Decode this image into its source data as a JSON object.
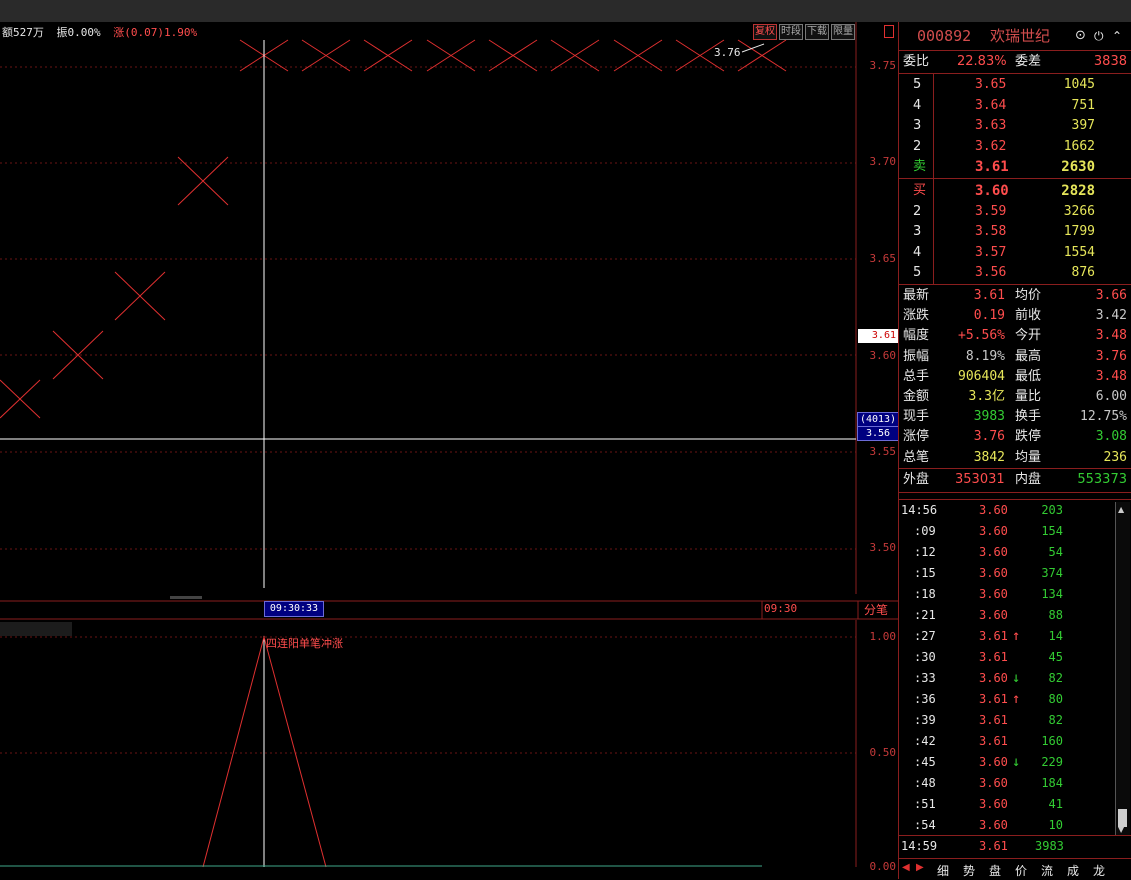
{
  "info": {
    "amount": "额527万",
    "amplitude": "振0.00%",
    "change": "涨(0.07)1.90%"
  },
  "toolbar": {
    "fuquan": "复权",
    "shiduan": "时段",
    "xiazai": "下载",
    "xianliang": "限量"
  },
  "chart": {
    "y_labels": [
      "3.75",
      "3.70",
      "3.65",
      "3.60",
      "3.55",
      "3.50"
    ],
    "annotation": "3.76",
    "current_price_marker": "3.61",
    "crosshair_volume": "(4013)",
    "crosshair_price": "3.56",
    "crosshair_time": "09:30:33",
    "axis_time_right": "09:30",
    "fenbi": "分笔",
    "lower_labels": [
      "1.00",
      "0.50",
      "0.00"
    ],
    "signal_label": "四连阳单笔冲涨"
  },
  "stock": {
    "code": "000892",
    "name": "欢瑞世纪"
  },
  "orderbook": {
    "weibi_label": "委比",
    "weibi": "22.83%",
    "weicha_label": "委差",
    "weicha": "3838",
    "sell": [
      {
        "level": "5",
        "price": "3.65",
        "vol": "1045"
      },
      {
        "level": "4",
        "price": "3.64",
        "vol": "751"
      },
      {
        "level": "3",
        "price": "3.63",
        "vol": "397"
      },
      {
        "level": "2",
        "price": "3.62",
        "vol": "1662"
      },
      {
        "level": "卖",
        "price": "3.61",
        "vol": "2630"
      }
    ],
    "buy": [
      {
        "level": "买",
        "price": "3.60",
        "vol": "2828"
      },
      {
        "level": "2",
        "price": "3.59",
        "vol": "3266"
      },
      {
        "level": "3",
        "price": "3.58",
        "vol": "1799"
      },
      {
        "level": "4",
        "price": "3.57",
        "vol": "1554"
      },
      {
        "level": "5",
        "price": "3.56",
        "vol": "876"
      }
    ]
  },
  "quote": [
    {
      "l1": "最新",
      "v1": "3.61",
      "c1": "red",
      "l2": "均价",
      "v2": "3.66",
      "c2": "red"
    },
    {
      "l1": "涨跌",
      "v1": "0.19",
      "c1": "red",
      "l2": "前收",
      "v2": "3.42",
      "c2": "gray"
    },
    {
      "l1": "幅度",
      "v1": "+5.56%",
      "c1": "red",
      "l2": "今开",
      "v2": "3.48",
      "c2": "red"
    },
    {
      "l1": "振幅",
      "v1": "8.19%",
      "c1": "gray",
      "l2": "最高",
      "v2": "3.76",
      "c2": "red"
    },
    {
      "l1": "总手",
      "v1": "906404",
      "c1": "yellow",
      "l2": "最低",
      "v2": "3.48",
      "c2": "red"
    },
    {
      "l1": "金额",
      "v1": "3.3亿",
      "c1": "yellow",
      "l2": "量比",
      "v2": "6.00",
      "c2": "gray"
    },
    {
      "l1": "现手",
      "v1": "3983",
      "c1": "green",
      "l2": "换手",
      "v2": "12.75%",
      "c2": "gray"
    },
    {
      "l1": "涨停",
      "v1": "3.76",
      "c1": "red",
      "l2": "跌停",
      "v2": "3.08",
      "c2": "green"
    },
    {
      "l1": "总笔",
      "v1": "3842",
      "c1": "yellow",
      "l2": "均量",
      "v2": "236",
      "c2": "yellow"
    }
  ],
  "waipan": {
    "label": "外盘",
    "value": "353031"
  },
  "neipan": {
    "label": "内盘",
    "value": "553373"
  },
  "ticks": [
    {
      "t": "14:56",
      "p": "3.60",
      "a": "",
      "v": "203"
    },
    {
      "t": ":09",
      "p": "3.60",
      "a": "",
      "v": "154"
    },
    {
      "t": ":12",
      "p": "3.60",
      "a": "",
      "v": "54"
    },
    {
      "t": ":15",
      "p": "3.60",
      "a": "",
      "v": "374"
    },
    {
      "t": ":18",
      "p": "3.60",
      "a": "",
      "v": "134"
    },
    {
      "t": ":21",
      "p": "3.60",
      "a": "",
      "v": "88"
    },
    {
      "t": ":27",
      "p": "3.61",
      "a": "↑",
      "v": "14"
    },
    {
      "t": ":30",
      "p": "3.61",
      "a": "",
      "v": "45"
    },
    {
      "t": ":33",
      "p": "3.60",
      "a": "↓",
      "v": "82"
    },
    {
      "t": ":36",
      "p": "3.61",
      "a": "↑",
      "v": "80"
    },
    {
      "t": ":39",
      "p": "3.61",
      "a": "",
      "v": "82"
    },
    {
      "t": ":42",
      "p": "3.61",
      "a": "",
      "v": "160"
    },
    {
      "t": ":45",
      "p": "3.60",
      "a": "↓",
      "v": "229"
    },
    {
      "t": ":48",
      "p": "3.60",
      "a": "",
      "v": "184"
    },
    {
      "t": ":51",
      "p": "3.60",
      "a": "",
      "v": "41"
    },
    {
      "t": ":54",
      "p": "3.60",
      "a": "",
      "v": "10"
    }
  ],
  "last_tick": {
    "t": "14:59",
    "p": "3.61",
    "v": "3983"
  },
  "bottom_tabs": [
    "细",
    "势",
    "盘",
    "价",
    "流",
    "成",
    "龙"
  ]
}
